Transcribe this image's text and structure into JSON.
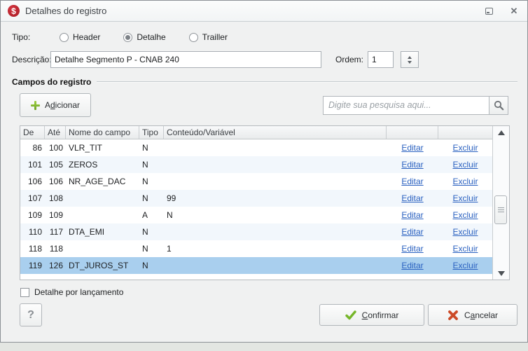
{
  "window": {
    "title": "Detalhes do registro",
    "icon_glyph": "$"
  },
  "tipo": {
    "label": "Tipo:",
    "options": [
      {
        "label": "Header",
        "selected": false
      },
      {
        "label": "Detalhe",
        "selected": true
      },
      {
        "label": "Trailler",
        "selected": false
      }
    ]
  },
  "descricao": {
    "label": "Descrição:",
    "value": "Detalhe Segmento P - CNAB 240"
  },
  "ordem": {
    "label": "Ordem:",
    "value": "1"
  },
  "group": {
    "title": "Campos do registro"
  },
  "toolbar": {
    "add_button": {
      "label": "Adicionar",
      "accel_index": 1
    },
    "search_placeholder": "Digite sua pesquisa aqui..."
  },
  "table": {
    "columns": {
      "de": "De",
      "ate": "Até",
      "nome": "Nome do campo",
      "tipo": "Tipo",
      "conteudo": "Conteúdo/Variável",
      "edit": "",
      "del": ""
    },
    "edit_label": "Editar",
    "delete_label": "Excluir",
    "selected_index": 7,
    "rows": [
      {
        "de": "86",
        "ate": "100",
        "nome": "VLR_TIT",
        "tipo": "N",
        "conteudo": ""
      },
      {
        "de": "101",
        "ate": "105",
        "nome": "ZEROS",
        "tipo": "N",
        "conteudo": ""
      },
      {
        "de": "106",
        "ate": "106",
        "nome": "NR_AGE_DAC",
        "tipo": "N",
        "conteudo": ""
      },
      {
        "de": "107",
        "ate": "108",
        "nome": "",
        "tipo": "N",
        "conteudo": "99"
      },
      {
        "de": "109",
        "ate": "109",
        "nome": "",
        "tipo": "A",
        "conteudo": "N"
      },
      {
        "de": "110",
        "ate": "117",
        "nome": "DTA_EMI",
        "tipo": "N",
        "conteudo": ""
      },
      {
        "de": "118",
        "ate": "118",
        "nome": "",
        "tipo": "N",
        "conteudo": "1"
      },
      {
        "de": "119",
        "ate": "126",
        "nome": "DT_JUROS_ST",
        "tipo": "N",
        "conteudo": ""
      }
    ]
  },
  "footer": {
    "checkbox_label": "Detalhe por lançamento",
    "checkbox_checked": false,
    "help_label": "?",
    "confirm_button": {
      "label": "Confirmar",
      "accel_index": 0
    },
    "cancel_button": {
      "label": "Cancelar",
      "accel_index": 1
    }
  },
  "colors": {
    "selected_row": "#a9cfee",
    "alt_row": "#f2f7fc",
    "link": "#2a61c0",
    "app_icon_bg": "#a81b24",
    "add_icon_green": "#7cb52b",
    "confirm_icon_green": "#76b629",
    "cancel_icon_red": "#cc4b28"
  }
}
